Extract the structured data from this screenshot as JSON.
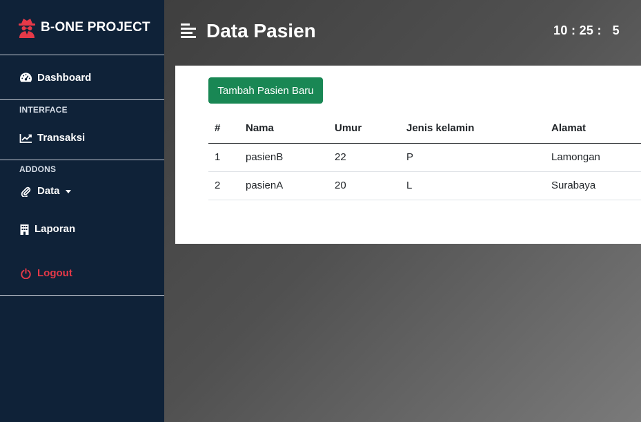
{
  "brand": {
    "name": "B-ONE PROJECT",
    "icon": "spy-icon"
  },
  "sidebar": {
    "dashboard": {
      "label": "Dashboard",
      "icon": "gauge-icon"
    },
    "interface_heading": "INTERFACE",
    "transaksi": {
      "label": "Transaksi",
      "icon": "chart-line-icon"
    },
    "addons_heading": "ADDONS",
    "data": {
      "label": "Data",
      "icon": "paperclip-icon"
    },
    "laporan": {
      "label": "Laporan",
      "icon": "building-icon"
    },
    "logout": {
      "label": "Logout",
      "icon": "power-icon"
    }
  },
  "header": {
    "title": "Data Pasien",
    "clock": "10 : 25 :   5"
  },
  "main": {
    "add_button": "Tambah Pasien Baru",
    "table": {
      "columns": [
        "#",
        "Nama",
        "Umur",
        "Jenis kelamin",
        "Alamat"
      ],
      "rows": [
        [
          "1",
          "pasienB",
          "22",
          "P",
          "Lamongan"
        ],
        [
          "2",
          "pasienA",
          "20",
          "L",
          "Surabaya"
        ]
      ]
    }
  },
  "colors": {
    "sidebar_bg": "#0f2238",
    "brand_red": "#e53948",
    "button_green": "#198754"
  }
}
